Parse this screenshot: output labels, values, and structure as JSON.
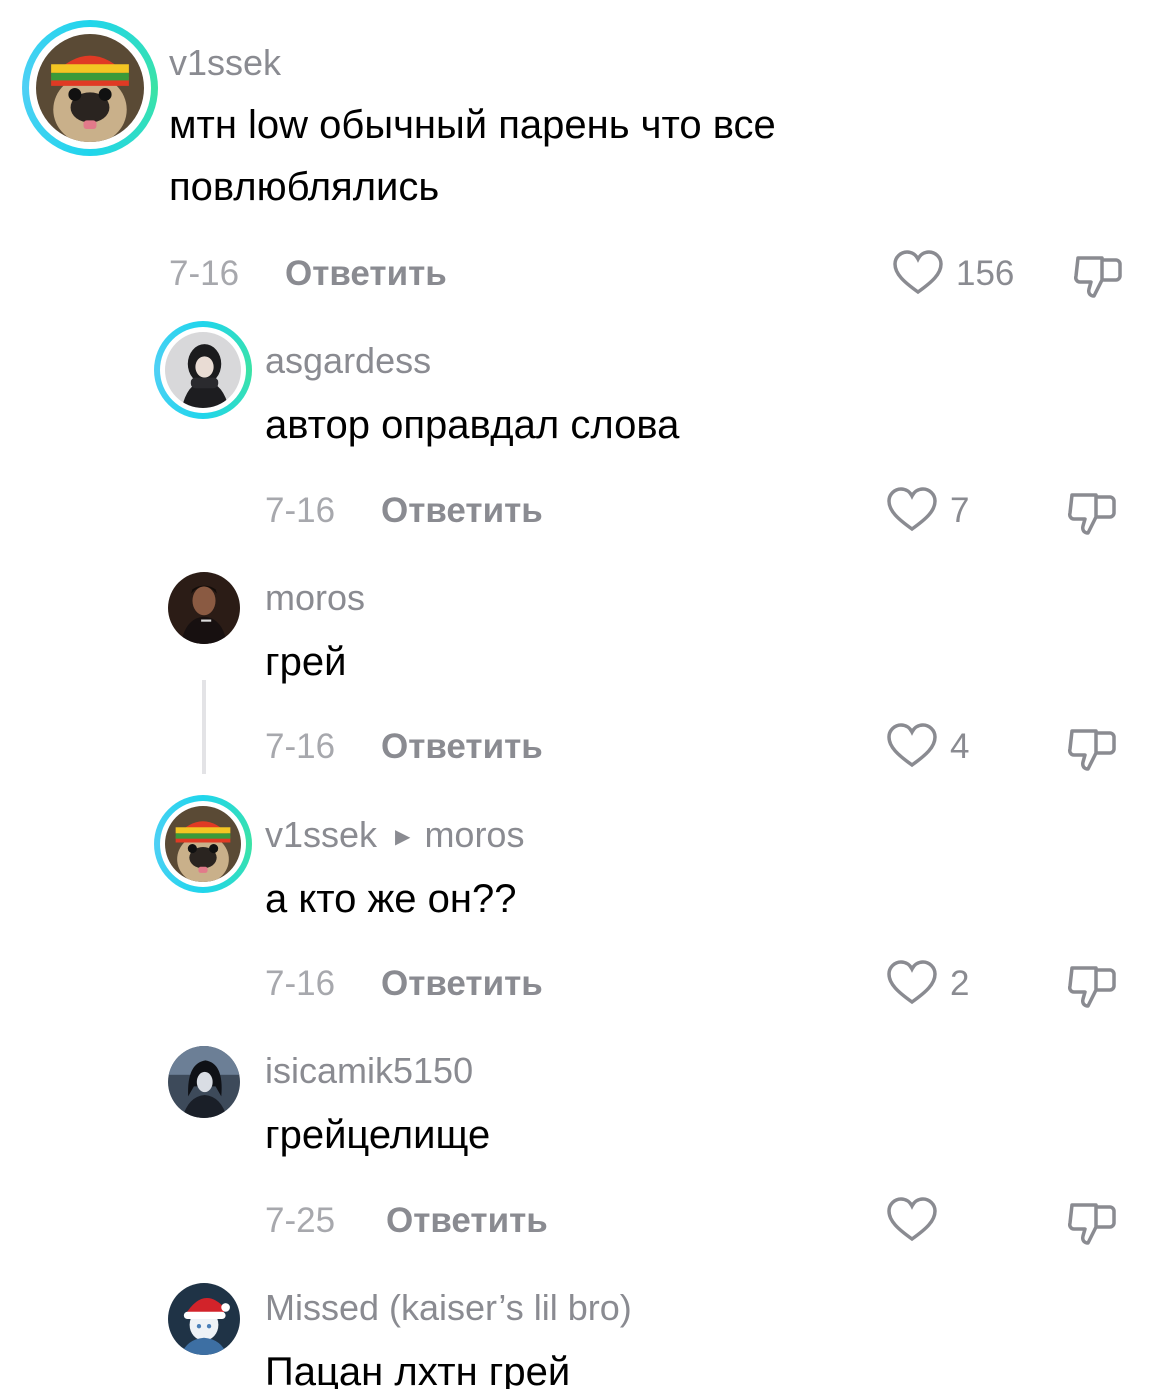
{
  "comments": [
    {
      "username": "v1ssek",
      "text_lines": [
        "мтн low обычный парень что все",
        "повлюблялись"
      ],
      "date": "7-16",
      "reply_label": "Ответить",
      "likes": "156",
      "avatar": "pug-rasta-avatar",
      "ring": true
    },
    {
      "username": "asgardess",
      "text_lines": [
        "автор оправдал слова"
      ],
      "date": "7-16",
      "reply_label": "Ответить",
      "likes": "7",
      "avatar": "dark-hair-girl-avatar",
      "ring": true
    },
    {
      "username": "moros",
      "text_lines": [
        "грей"
      ],
      "date": "7-16",
      "reply_label": "Ответить",
      "likes": "4",
      "avatar": "man-smoking-avatar",
      "ring": false
    },
    {
      "username": "v1ssek",
      "reply_to": "moros",
      "text_lines": [
        "а кто же он??"
      ],
      "date": "7-16",
      "reply_label": "Ответить",
      "likes": "2",
      "avatar": "pug-rasta-avatar",
      "ring": true
    },
    {
      "username": "isicamik5150",
      "text_lines": [
        "грейцелище"
      ],
      "date": "7-25",
      "reply_label": "Ответить",
      "likes": "",
      "avatar": "anime-dark-avatar",
      "ring": false
    },
    {
      "username": "Missed (kaiser’s lil bro)",
      "text_lines": [
        "Пацан лхтн грей"
      ],
      "avatar": "anime-santa-hat-avatar",
      "ring": false
    }
  ],
  "colors": {
    "ring": "#20d5ec",
    "meta": "#8a8b91",
    "text": "#000000"
  },
  "icons": {
    "like": "heart-outline-icon",
    "dislike": "thumbs-down-icon",
    "reply_arrow": "triangle-right-icon"
  }
}
